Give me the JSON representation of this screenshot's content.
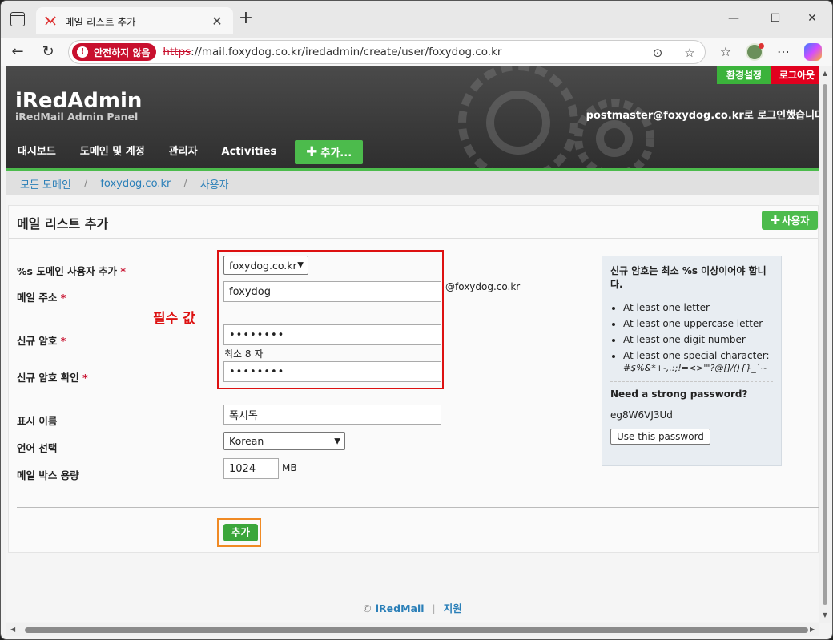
{
  "browser": {
    "tab_title": "메일 리스트 추가",
    "tab_close": "✕",
    "new_tab": "+",
    "insecure_label": "안전하지 않음",
    "url_scheme": "https",
    "url_rest": "://mail.foxydog.co.kr/iredadmin/create/user/foxydog.co.kr"
  },
  "header": {
    "title": "iRedAdmin",
    "subtitle": "iRedMail Admin Panel",
    "login_info": "postmaster@foxydog.co.kr로 로그인했습니다.",
    "settings_label": "환경설정",
    "logout_label": "로그아웃",
    "nav": {
      "dashboard": "대시보드",
      "domains": "도메인 및 계정",
      "admins": "관리자",
      "activities": "Activities",
      "add": "추가..."
    }
  },
  "breadcrumb": {
    "all_domains": "모든 도메인",
    "domain": "foxydog.co.kr",
    "users": "사용자",
    "sep": "/"
  },
  "form": {
    "title": "메일 리스트 추가",
    "add_user_label": "사용자",
    "required_mark": "*",
    "domain_label": "%s 도메인 사용자 추가",
    "domain_value": "foxydog.co.kr",
    "email_label": "메일 주소",
    "email_value": "foxydog",
    "email_suffix": "@foxydog.co.kr",
    "password_label": "신규 암호",
    "password_value": "••••••••",
    "password_hint": "최소 8 자",
    "confirm_label": "신규 암호 확인",
    "confirm_value": "••••••••",
    "required_note": "필수 값",
    "display_name_label": "표시 이름",
    "display_name_value": "폭시독",
    "language_label": "언어 선택",
    "language_value": "Korean",
    "quota_label": "메일 박스 용량",
    "quota_value": "1024",
    "quota_unit": "MB",
    "submit_label": "추가"
  },
  "password_rules": {
    "heading": "신규 암호는 최소 %s 이상이어야 합니다.",
    "rules": [
      "At least one letter",
      "At least one uppercase letter",
      "At least one digit number",
      "At least one special character:"
    ],
    "special_chars": "#$%&*+-,.:;!=<>'\"?@[]/(){}_`~",
    "need_strong": "Need a strong password?",
    "generated": "eg8W6VJ3Ud",
    "use_button": "Use this password"
  },
  "footer": {
    "copyright": "©",
    "brand": "iRedMail",
    "sep": "|",
    "support": "지원"
  },
  "colors": {
    "accent_green": "#4cbb4c",
    "logout_red": "#e1001e",
    "link_blue": "#2a7fb8",
    "annotation_red": "#dd1111",
    "annotation_orange": "#f08a24"
  }
}
